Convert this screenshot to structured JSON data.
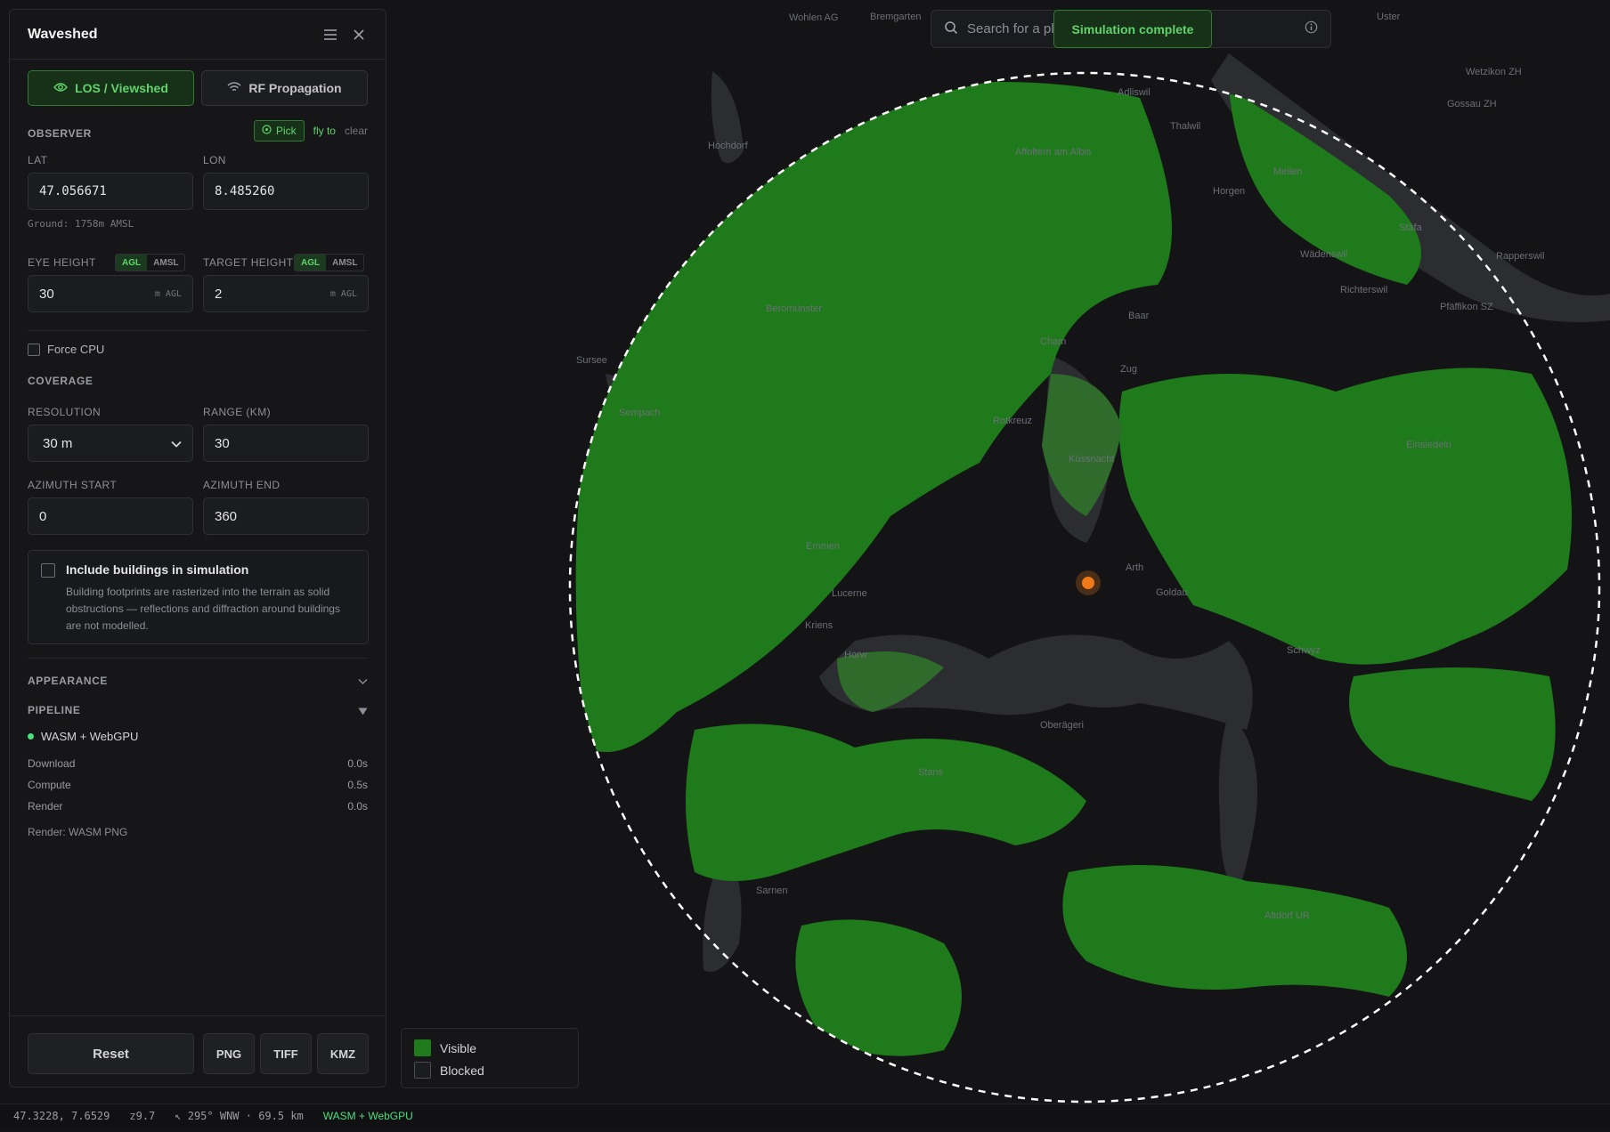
{
  "app": {
    "title": "Waveshed"
  },
  "tabs": [
    {
      "label": "LOS / Viewshed",
      "icon": "eye-icon",
      "active": true
    },
    {
      "label": "RF Propagation",
      "icon": "wifi-icon",
      "active": false
    }
  ],
  "observer": {
    "section_label": "OBSERVER",
    "pick_label": "Pick",
    "fly_to_label": "fly to",
    "clear_label": "clear",
    "lat_label": "LAT",
    "lat_value": "47.056671",
    "lon_label": "LON",
    "lon_value": "8.485260",
    "ground_text": "Ground: 1758m AMSL"
  },
  "heights": {
    "eye_label": "EYE HEIGHT",
    "target_label": "TARGET HEIGHT",
    "agl": "AGL",
    "amsl": "AMSL",
    "eye_value": "30",
    "target_value": "2",
    "unit": "m AGL"
  },
  "force_cpu_label": "Force CPU",
  "coverage": {
    "section_label": "COVERAGE",
    "resolution_label": "RESOLUTION",
    "resolution_value": "30 m",
    "range_label": "RANGE (KM)",
    "range_value": "30",
    "az_start_label": "AZIMUTH START",
    "az_start_value": "0",
    "az_end_label": "AZIMUTH END",
    "az_end_value": "360"
  },
  "buildings": {
    "title": "Include buildings in simulation",
    "desc": "Building footprints are rasterized into the terrain as solid obstructions — reflections and diffraction around buildings are not modelled."
  },
  "appearance_label": "APPEARANCE",
  "pipeline": {
    "section_label": "PIPELINE",
    "engine": "WASM + WebGPU",
    "rows": [
      {
        "label": "Download",
        "value": "0.0s"
      },
      {
        "label": "Compute",
        "value": "0.5s"
      },
      {
        "label": "Render",
        "value": "0.0s"
      }
    ],
    "render_text": "Render: WASM PNG"
  },
  "actions": {
    "reset": "Reset",
    "png": "PNG",
    "tiff": "TIFF",
    "kmz": "KMZ"
  },
  "search": {
    "placeholder": "Search for a pla",
    "toast": "Simulation complete"
  },
  "legend": {
    "visible": "Visible",
    "blocked": "Blocked"
  },
  "status": {
    "coords": "47.3228, 7.6529",
    "zoom": "z9.7",
    "bearing": "↖ 295° WNW · 69.5 km",
    "engine": "WASM + WebGPU"
  },
  "map_labels": [
    "Wohlen AG",
    "Bremgarten",
    "Uster",
    "Wetzikon ZH",
    "Gossau ZH",
    "Affoltern am Albis",
    "Adliswil",
    "Thalwil",
    "Horgen",
    "Meilen",
    "Stäfa",
    "Wädenswil",
    "Richterswil",
    "Rapperswil",
    "Pfäffikon SZ",
    "Sursee",
    "Baar",
    "Cham",
    "Zug",
    "Rotkreuz",
    "Einsiedeln",
    "Emmen",
    "Lucerne",
    "Kriens",
    "Horw",
    "Arth",
    "Goldau",
    "Schwyz",
    "Stans",
    "Sarnen",
    "Altdorf UR",
    "Beromünster",
    "Sempach",
    "Hochdorf",
    "Küssnacht",
    "Oberägeri"
  ],
  "colors": {
    "visible": "#1e7a1a",
    "accent": "#5fd36a",
    "observer": "#f07a1a"
  }
}
